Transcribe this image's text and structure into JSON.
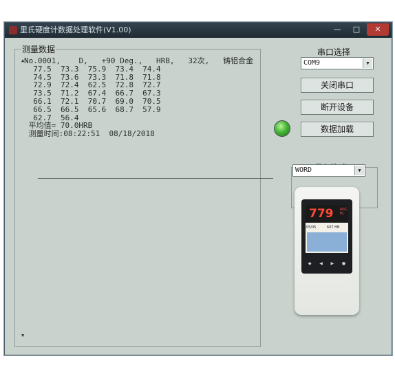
{
  "window": {
    "title": "里氏硬度计数据处理软件(V1.00)",
    "controls": {
      "minimize": "—",
      "maximize": "□",
      "close": "✕"
    }
  },
  "measure_panel": {
    "title": "测量数据",
    "lines": [
      "No.0001,    D,   +90 Deg.,   HRB,   32次,   铸铝合金",
      "  77.5  73.3  75.9  73.4  74.4",
      "  74.5  73.6  73.3  71.8  71.8",
      "  72.9  72.4  62.5  72.8  72.7",
      "  73.5  71.2  67.4  66.7  67.3",
      "  66.1  72.1  70.7  69.0  70.5",
      "  66.5  66.5  65.6  68.7  57.9",
      "  62.7  56.4",
      " 平均值= 70.0HRB",
      " 测量时间:08:22:51  08/18/2018"
    ]
  },
  "port": {
    "label": "串口选择",
    "selected": "COM9",
    "close_port_button": "关闭串口",
    "disconnect_button": "断开设备",
    "load_data_button": "数据加载"
  },
  "format": {
    "label": "保存格式",
    "selected": "WORD"
  },
  "device": {
    "reading": "779",
    "mode": "AVG",
    "mode2": "HL",
    "row_left": "05/05",
    "row_right": "607 HB"
  }
}
